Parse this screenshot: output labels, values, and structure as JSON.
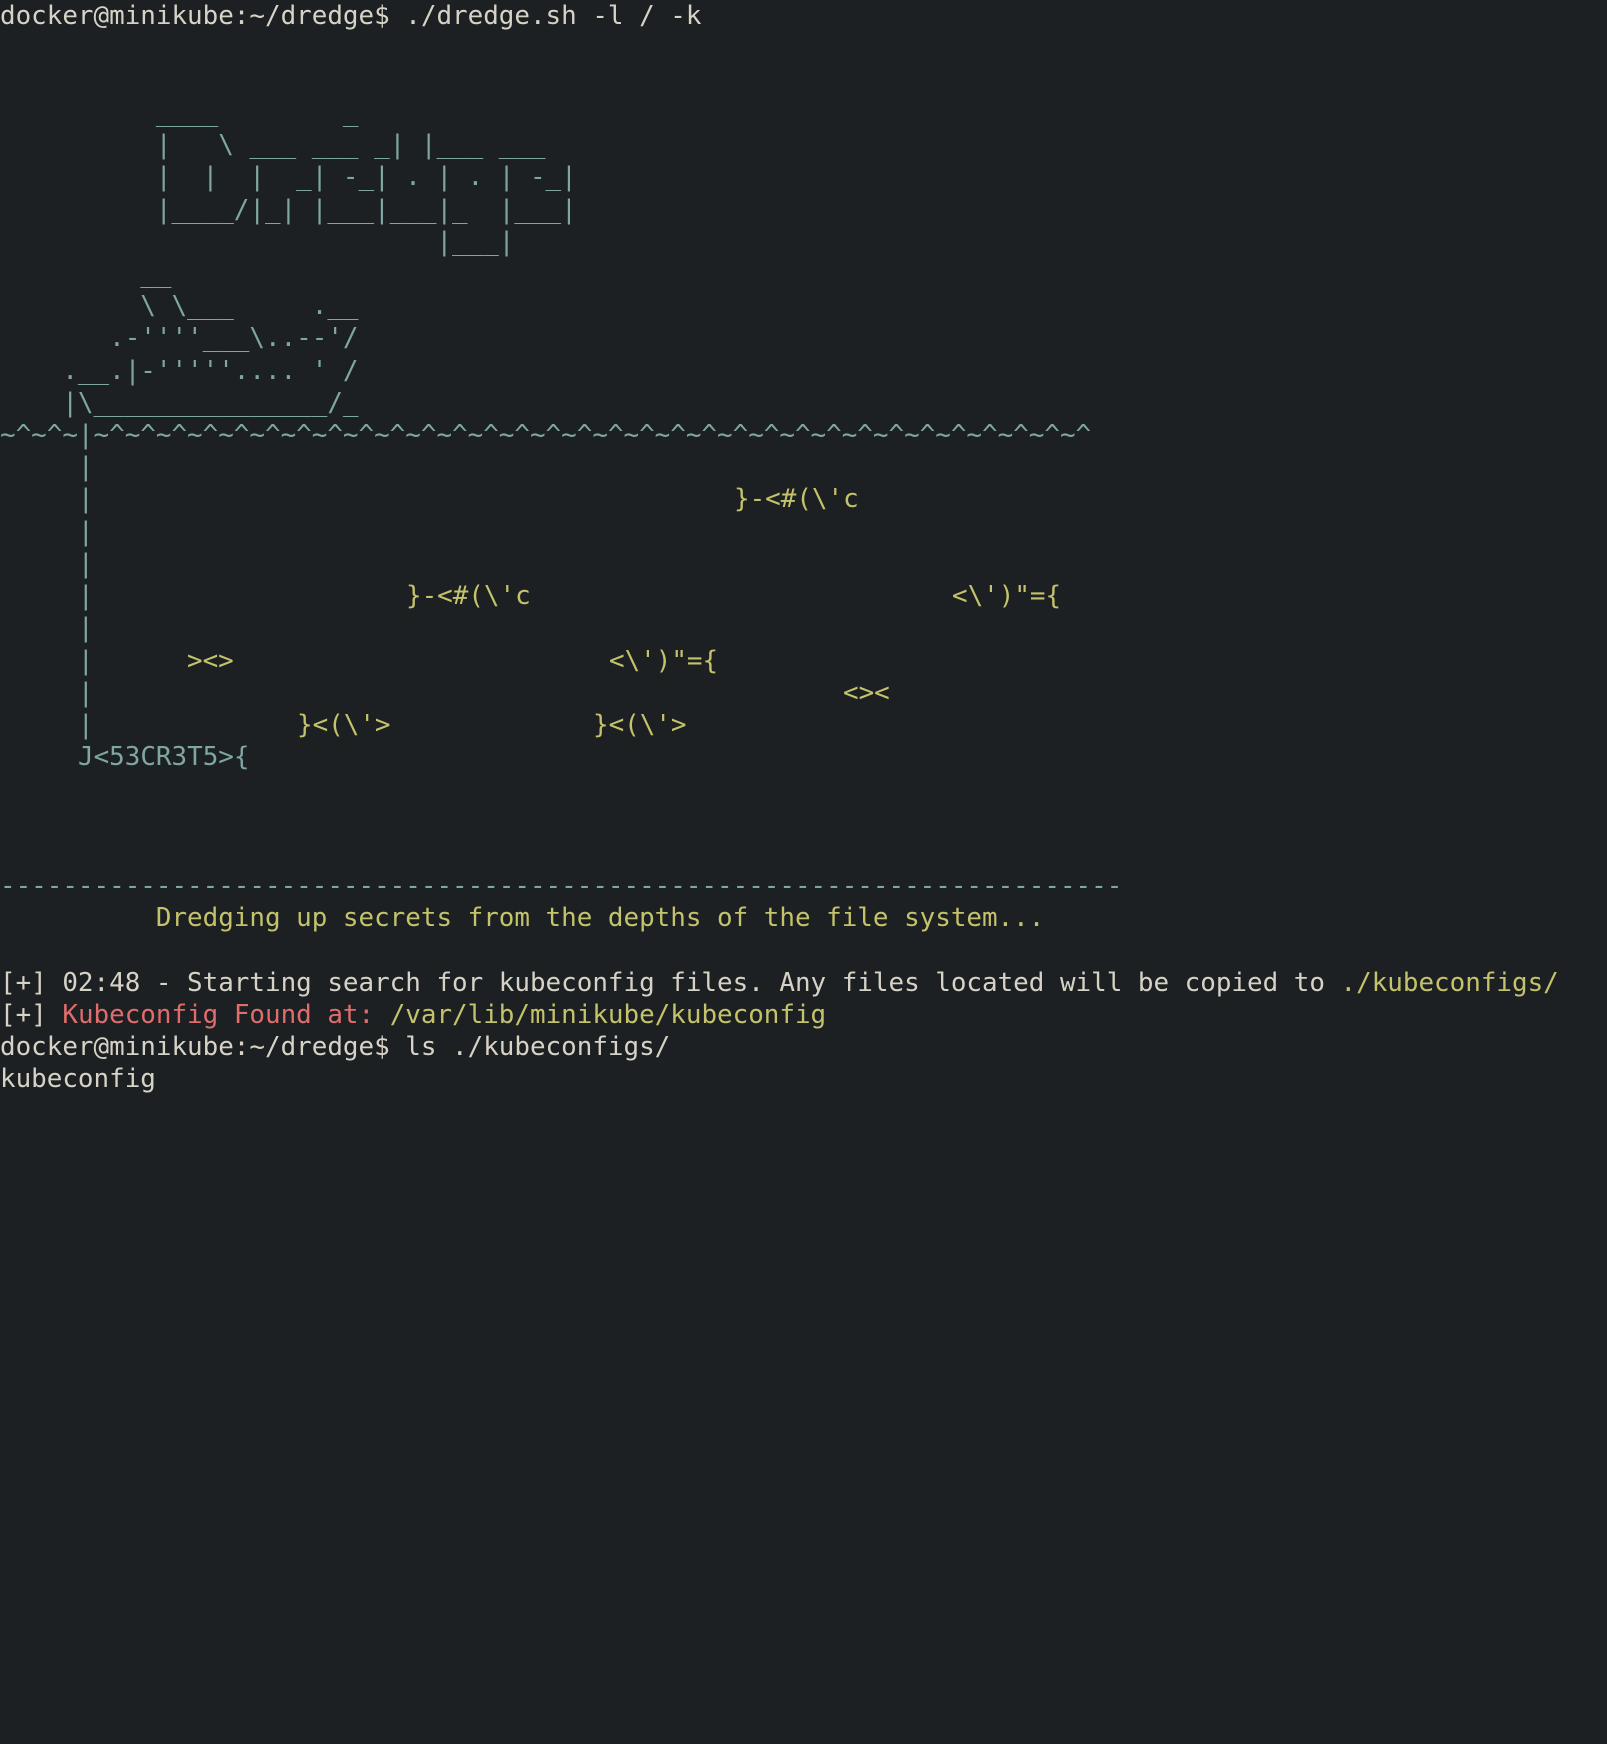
{
  "terminal": {
    "prompt_line_1": "docker@minikube:~/dredge$ ./dredge.sh -l / -k",
    "logo_lines": [
      "          ____        _",
      "          |   \\ ___ ___ _| |___ ___",
      "          |  |  |  _| -_| . | . | -_|",
      "          |____/|_| |___|___|_  |___|",
      "                            |___|"
    ],
    "ship_lines": [
      "         __",
      "         \\ \\___     .__",
      "       .-''''___\\..--'/",
      "    .__.|-'''''.... ' /",
      "    |\\_______________/_",
      "~^~^~|~^~^~^~^~^~^~^~^~^~^~^~^~^~^~^~^~^~^~^~^~^~^~^~^~^~^~^~^~^~^~^~^"
    ],
    "line_segments": [
      "|",
      "|",
      "|",
      "|",
      "|",
      "|",
      "|",
      "|",
      "|"
    ],
    "hook_label": "J<53CR3T5>{",
    "fish": [
      "}-<#(\\'c",
      "}-<#(\\'c",
      "<\\')\"={",
      "><>",
      "<\\')\"={",
      "<><",
      "}<(\\'>",
      "}<(\\'>"
    ],
    "divider": "------------------------------------------------------------------------",
    "tagline": "          Dredging up secrets from the depths of the file system...",
    "status_1_prefix": "[+] 02:48 - Starting search for kubeconfig files. Any files located will be copied to ",
    "status_1_path": "./kubeconfigs/",
    "status_2_prefix": "[+] ",
    "status_2_label": "Kubeconfig Found at:",
    "status_2_path": " /var/lib/minikube/kubeconfig",
    "prompt_line_2": "docker@minikube:~/dredge$ ls ./kubeconfigs/",
    "output_line": "kubeconfig"
  },
  "colors": {
    "background": "#1c2023",
    "ascii": "#7fa6a3",
    "highlight": "#c4c26a",
    "alert": "#e06c6c",
    "text": "#d6d3c6"
  }
}
